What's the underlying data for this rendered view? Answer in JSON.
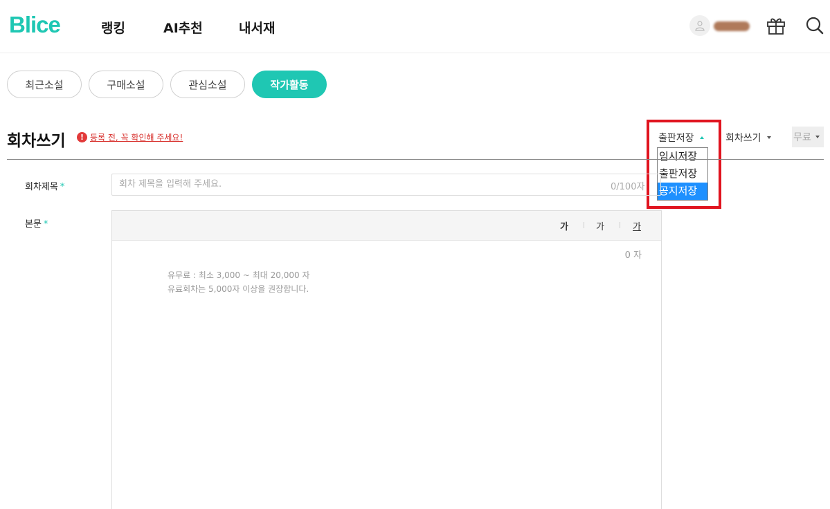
{
  "brand": {
    "logo": "Blice",
    "accent": "#1fc7b3"
  },
  "nav": {
    "items": [
      "랭킹",
      "AI추천",
      "내서재"
    ]
  },
  "header_icons": [
    "user-icon",
    "gift-icon",
    "search-icon"
  ],
  "tabs": [
    {
      "label": "최근소설",
      "active": false
    },
    {
      "label": "구매소설",
      "active": false
    },
    {
      "label": "관심소설",
      "active": false
    },
    {
      "label": "작가활동",
      "active": true
    }
  ],
  "page": {
    "title": "회차쓰기",
    "notice": "등록 전, 꼭 확인해 주세요!"
  },
  "controls": {
    "save_select": "출판저장",
    "save_options": [
      "임시저장",
      "출판저장",
      "공지저장"
    ],
    "save_highlighted": "공지저장",
    "mode_select": "회차쓰기",
    "price_select": "무료"
  },
  "form": {
    "title_label": "회차제목",
    "title_placeholder": "회차 제목을 입력해 주세요.",
    "title_count": "0/100자",
    "body_label": "본문",
    "required_mark": "*",
    "toolbar": [
      "가",
      "가",
      "가"
    ],
    "char_count": "0 자",
    "guide_line1": "유무료 : 최소 3,000 ~ 최대 20,000 자",
    "guide_line2": "유료회차는 5,000자 이상을 권장합니다."
  }
}
